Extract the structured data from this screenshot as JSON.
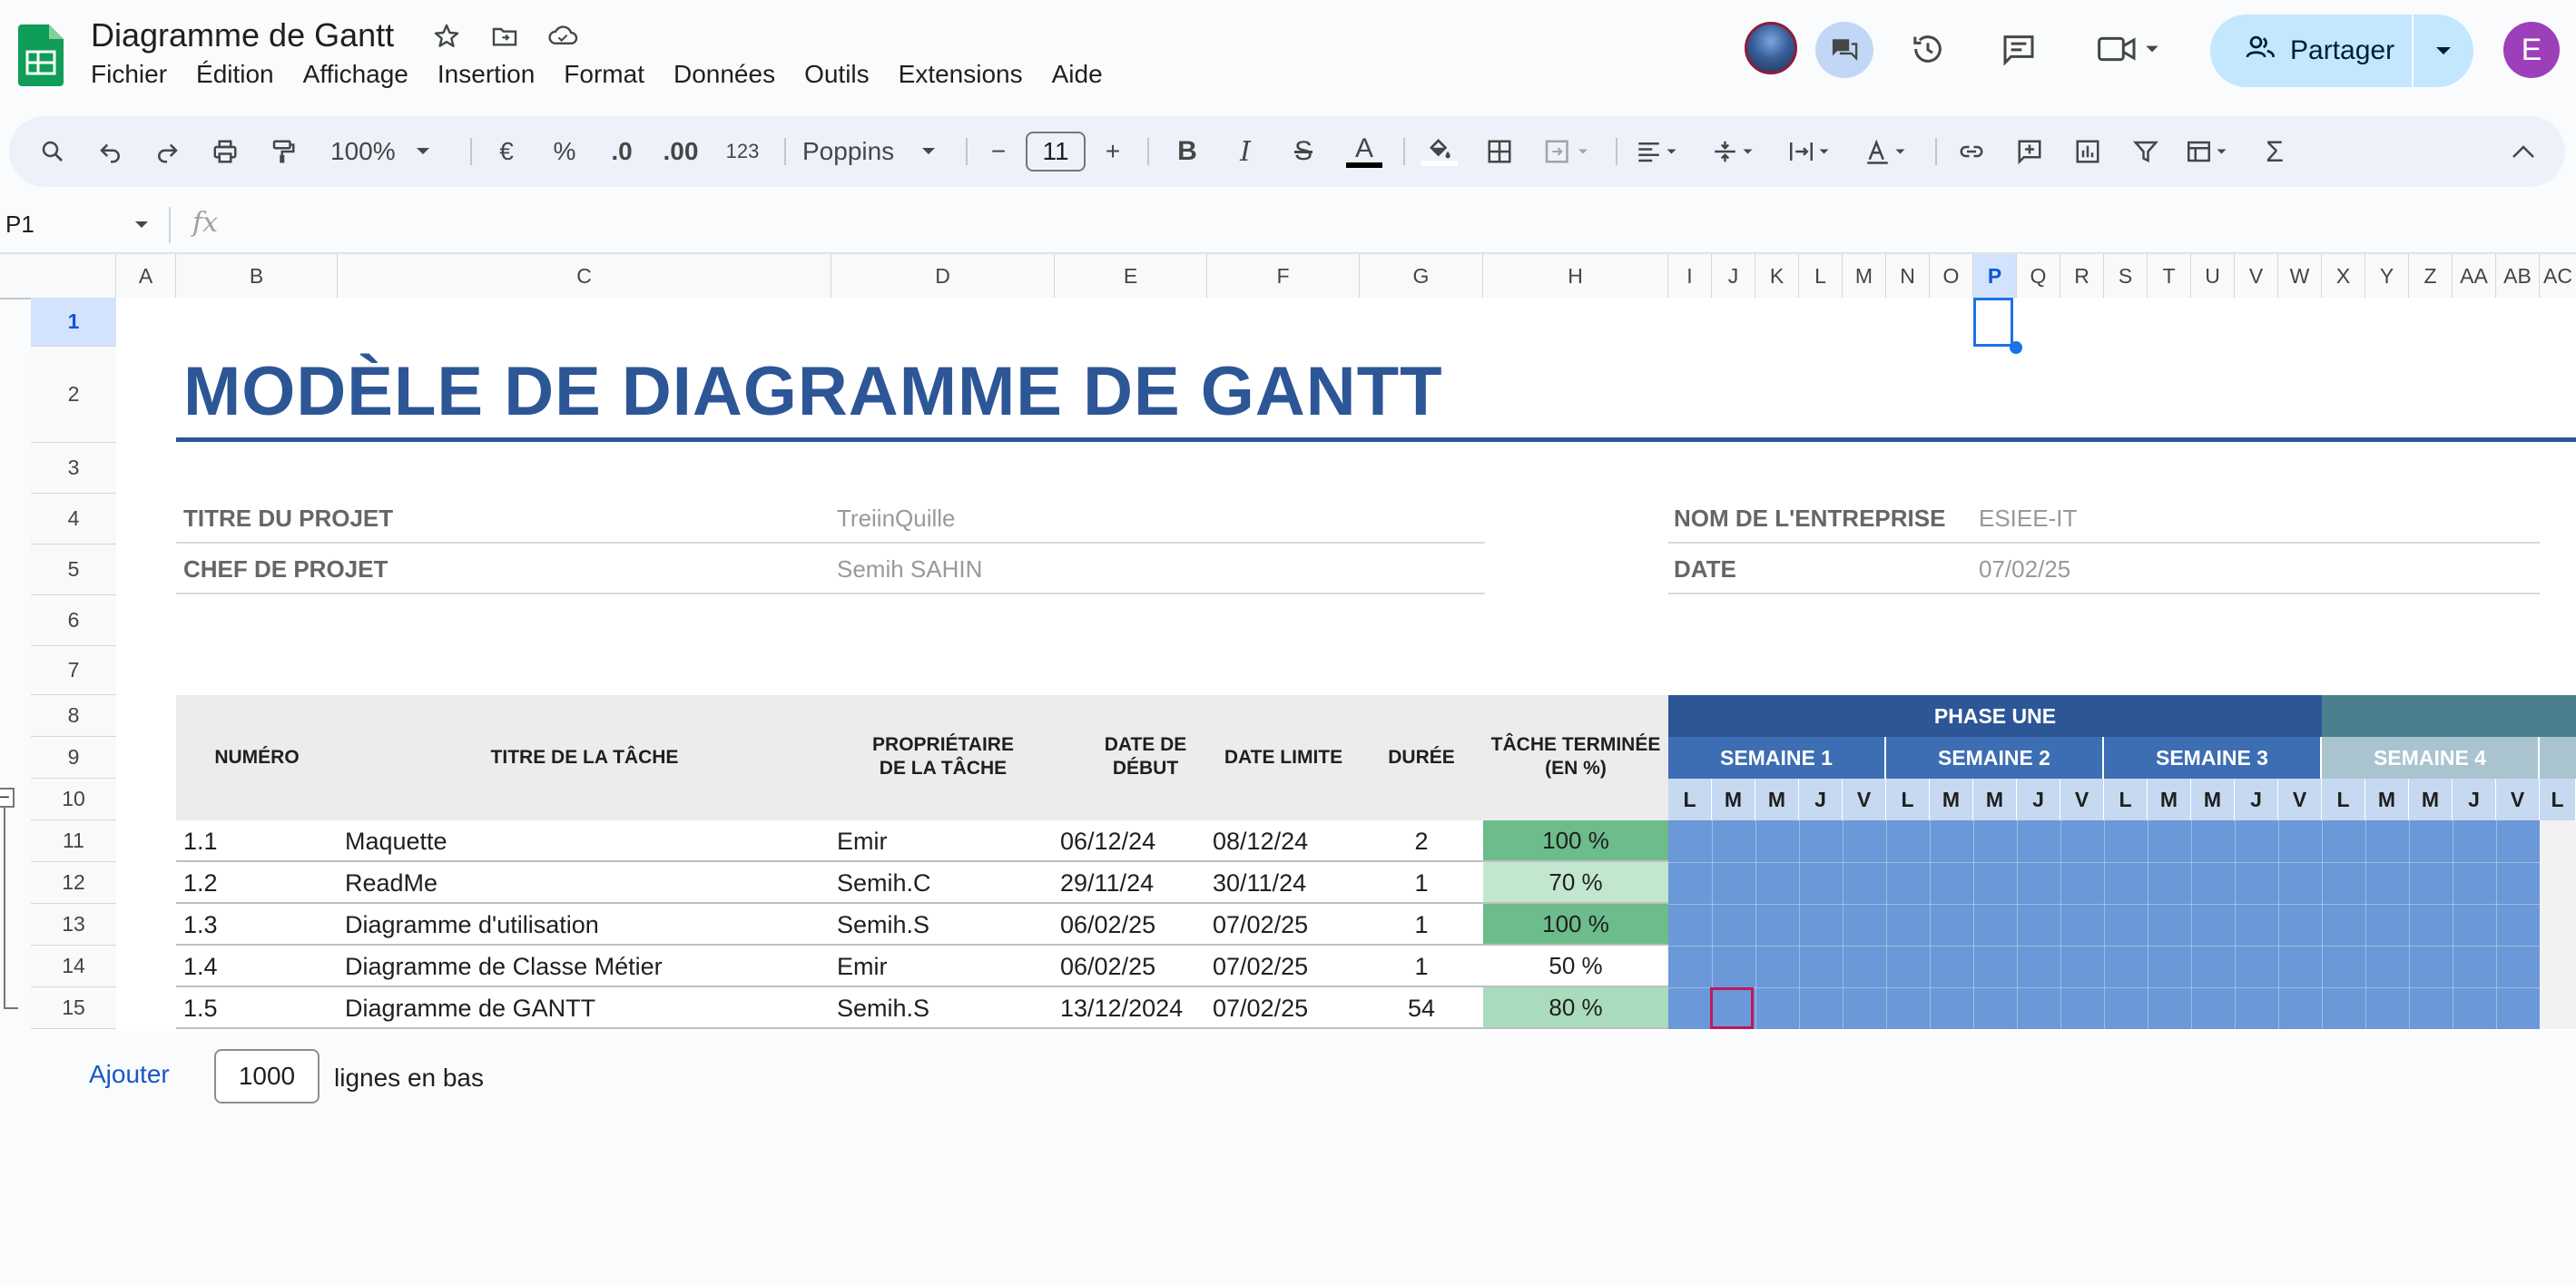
{
  "app": {
    "doc_title": "Diagramme de Gantt",
    "menu": [
      "Fichier",
      "Édition",
      "Affichage",
      "Insertion",
      "Format",
      "Données",
      "Outils",
      "Extensions",
      "Aide"
    ],
    "share_label": "Partager",
    "user_initial": "E"
  },
  "toolbar": {
    "zoom": "100%",
    "currency": "€",
    "percent": "%",
    "dec_less": ".0",
    "dec_more": ".00",
    "num_format": "123",
    "font": "Poppins",
    "font_size": "11",
    "minus": "−",
    "plus": "+",
    "bold": "B",
    "italic": "I",
    "strike": "S",
    "text_color": "A",
    "sigma": "Σ"
  },
  "formula_bar": {
    "cell_ref": "P1",
    "fx": "fx"
  },
  "grid": {
    "columns": [
      "A",
      "B",
      "C",
      "D",
      "E",
      "F",
      "G",
      "H",
      "I",
      "J",
      "K",
      "L",
      "M",
      "N",
      "O",
      "P",
      "Q",
      "R",
      "S",
      "T",
      "U",
      "V",
      "W",
      "X",
      "Y",
      "Z",
      "AA",
      "AB",
      "AC"
    ],
    "active_column": "P",
    "rows": [
      "1",
      "2",
      "3",
      "4",
      "5",
      "6",
      "7",
      "8",
      "9",
      "10",
      "11",
      "12",
      "13",
      "14",
      "15"
    ],
    "active_row": "1"
  },
  "sheet": {
    "title": "MODÈLE DE DIAGRAMME DE GANTT",
    "project_title_label": "TITRE DU PROJET",
    "project_title_value": "TreiinQuille",
    "manager_label": "CHEF DE PROJET",
    "manager_value": "Semih SAHIN",
    "company_label": "NOM DE L'ENTREPRISE",
    "company_value": "ESIEE-IT",
    "date_label": "DATE",
    "date_value": "07/02/25",
    "headers": {
      "numero": "NUMÉRO",
      "titre": "TITRE DE LA TÂCHE",
      "proprietaire": "PROPRIÉTAIRE DE LA TÂCHE",
      "debut": "DATE DE DÉBUT",
      "limite": "DATE LIMITE",
      "duree": "DURÉE",
      "terminee": "TÂCHE TERMINÉE (EN %)"
    },
    "phase": "PHASE UNE",
    "weeks": [
      "SEMAINE 1",
      "SEMAINE 2",
      "SEMAINE 3",
      "SEMAINE 4"
    ],
    "days": [
      "L",
      "M",
      "M",
      "J",
      "V",
      "L",
      "M",
      "M",
      "J",
      "V",
      "L",
      "M",
      "M",
      "J",
      "V",
      "L",
      "M",
      "M",
      "J",
      "V",
      "L"
    ],
    "tasks": [
      {
        "num": "1.1",
        "title": "Maquette",
        "owner": "Emir",
        "start": "06/12/24",
        "end": "08/12/24",
        "duration": "2",
        "done": "100 %",
        "done_color": "#6cbc8c"
      },
      {
        "num": "1.2",
        "title": "ReadMe",
        "owner": "Semih.C",
        "start": "29/11/24",
        "end": "30/11/24",
        "duration": "1",
        "done": "70 %",
        "done_color": "#c3e6cf"
      },
      {
        "num": "1.3",
        "title": "Diagramme d'utilisation",
        "owner": "Semih.S",
        "start": "06/02/25",
        "end": "07/02/25",
        "duration": "1",
        "done": "100 %",
        "done_color": "#6cbc8c"
      },
      {
        "num": "1.4",
        "title": "Diagramme de Classe Métier",
        "owner": "Emir",
        "start": "06/02/25",
        "end": "07/02/25",
        "duration": "1",
        "done": "50 %",
        "done_color": "#ffffff"
      },
      {
        "num": "1.5",
        "title": "Diagramme de GANTT",
        "owner": "Semih.S",
        "start": "13/12/2024",
        "end": "07/02/25",
        "duration": "54",
        "done": "80 %",
        "done_color": "#a9dcbd"
      }
    ]
  },
  "footer": {
    "add_label": "Ajouter",
    "rows_value": "1000",
    "rows_suffix": "lignes en bas"
  },
  "colors": {
    "title_blue": "#2d5697",
    "gantt_fill": "#6a98d8",
    "phase_teal": "#4a7f8e"
  }
}
